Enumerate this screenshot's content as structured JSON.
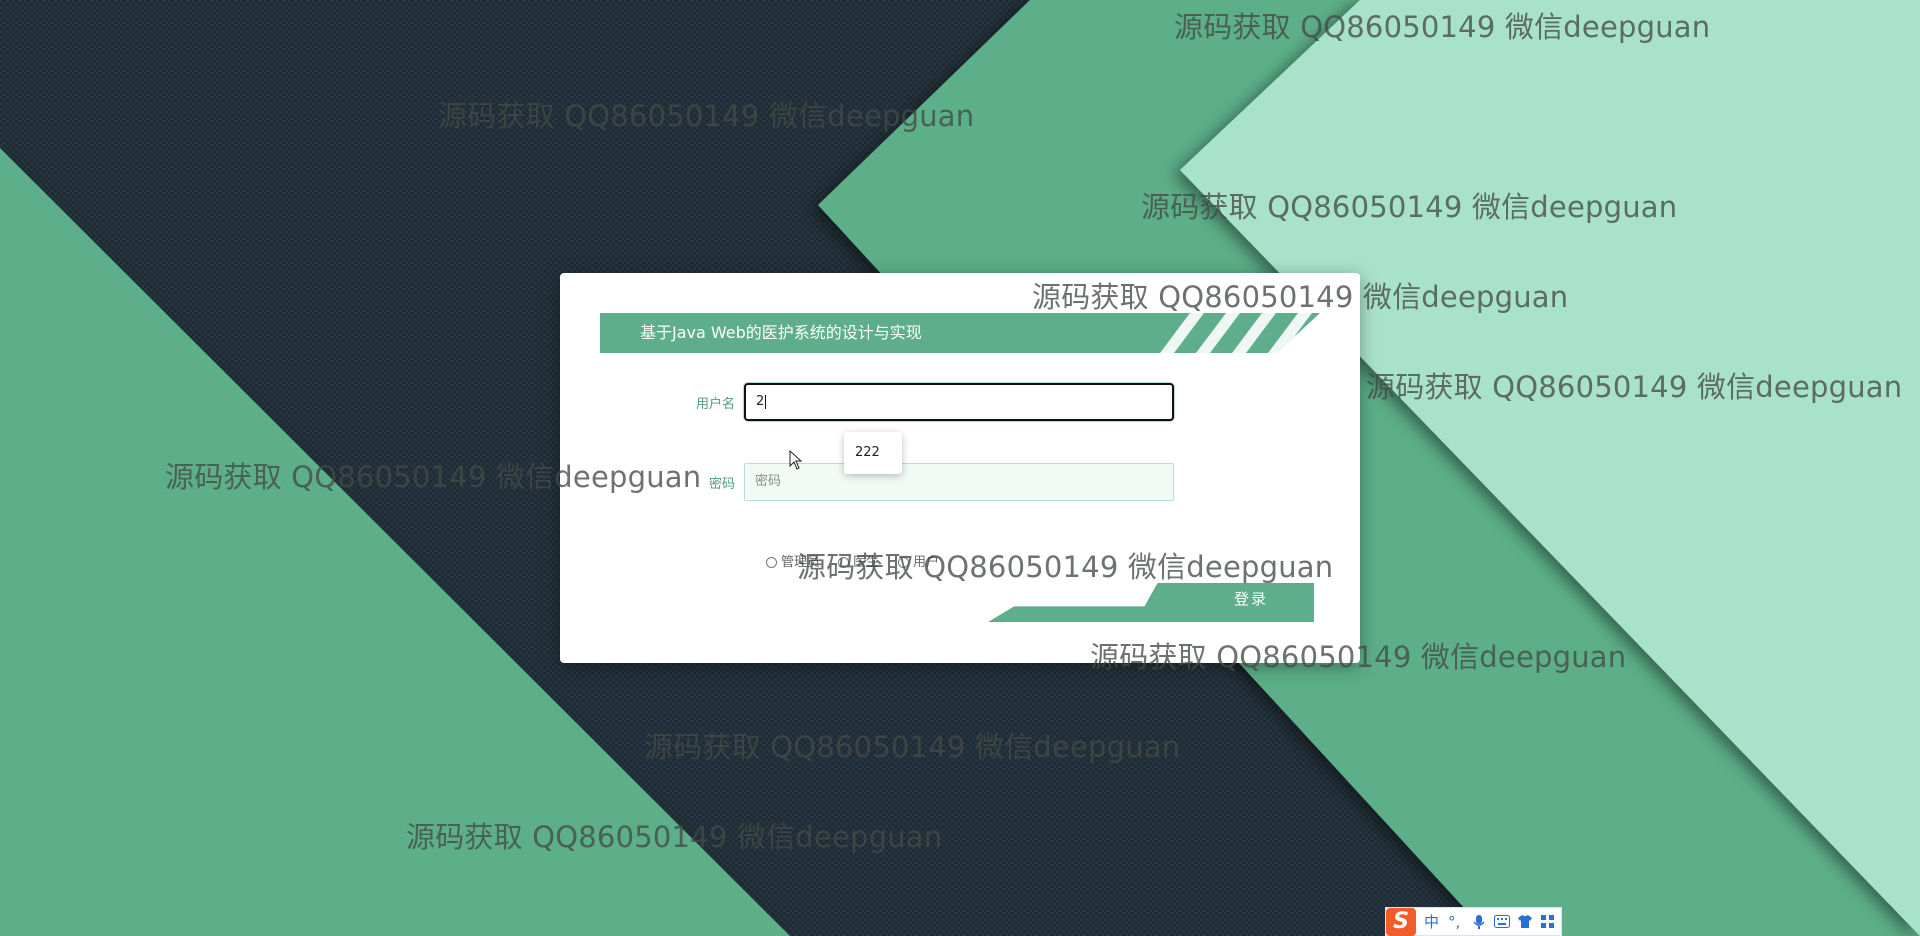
{
  "window": {
    "title": "基于Java Web的医护系统的设计与实现"
  },
  "login": {
    "username_label": "用户名",
    "username_value": "2",
    "autocomplete_option": "222",
    "password_label": "密码",
    "password_placeholder": "密码",
    "roles": [
      "管理员",
      "医生",
      "用户"
    ],
    "submit_label": "登录"
  },
  "watermark": {
    "text": "源码获取 QQ86050149 微信deepguan"
  },
  "ime_toolbar": {
    "logo": "S",
    "items": [
      "中",
      "°,",
      "mic-icon",
      "keyboard-icon",
      "shirt-icon",
      "toolbox-icon"
    ],
    "mode_label": "中",
    "punct_label": "°,"
  },
  "colors": {
    "accent": "#5fae8b",
    "accent_light": "#aee3cc",
    "dark_background": "#1d2a33",
    "ime_orange": "#f15c2a"
  }
}
